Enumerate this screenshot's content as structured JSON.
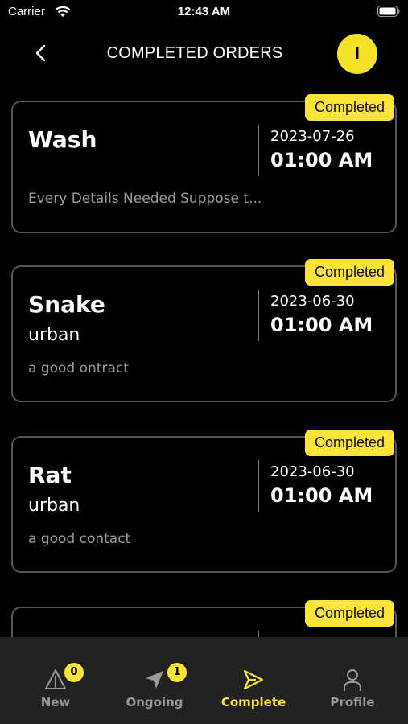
{
  "status_bar": {
    "carrier": "Carrier",
    "time": "12:43 AM"
  },
  "header": {
    "title": "COMPLETED ORDERS",
    "avatar_initial": "I"
  },
  "orders": [
    {
      "status": "Completed",
      "title": "Wash",
      "subtitle": "",
      "description": "Every Details Needed Suppose t...",
      "date": "2023-07-26",
      "time": "01:00 AM"
    },
    {
      "status": "Completed",
      "title": "Snake",
      "subtitle": "urban",
      "description": "a good ontract",
      "date": "2023-06-30",
      "time": "01:00 AM"
    },
    {
      "status": "Completed",
      "title": "Rat",
      "subtitle": "urban",
      "description": "a good contact",
      "date": "2023-06-30",
      "time": "01:00 AM"
    },
    {
      "status": "Completed",
      "title": "",
      "subtitle": "",
      "description": "",
      "date": "",
      "time": ""
    }
  ],
  "tabs": [
    {
      "label": "New",
      "icon": "warning-triangle-icon",
      "badge": "0"
    },
    {
      "label": "Ongoing",
      "icon": "navigation-arrow-icon",
      "badge": "1"
    },
    {
      "label": "Complete",
      "icon": "send-icon",
      "badge": ""
    },
    {
      "label": "Profile",
      "icon": "person-icon",
      "badge": ""
    }
  ],
  "colors": {
    "accent": "#fbe33a",
    "background": "#000000",
    "tabbar": "#222222"
  }
}
